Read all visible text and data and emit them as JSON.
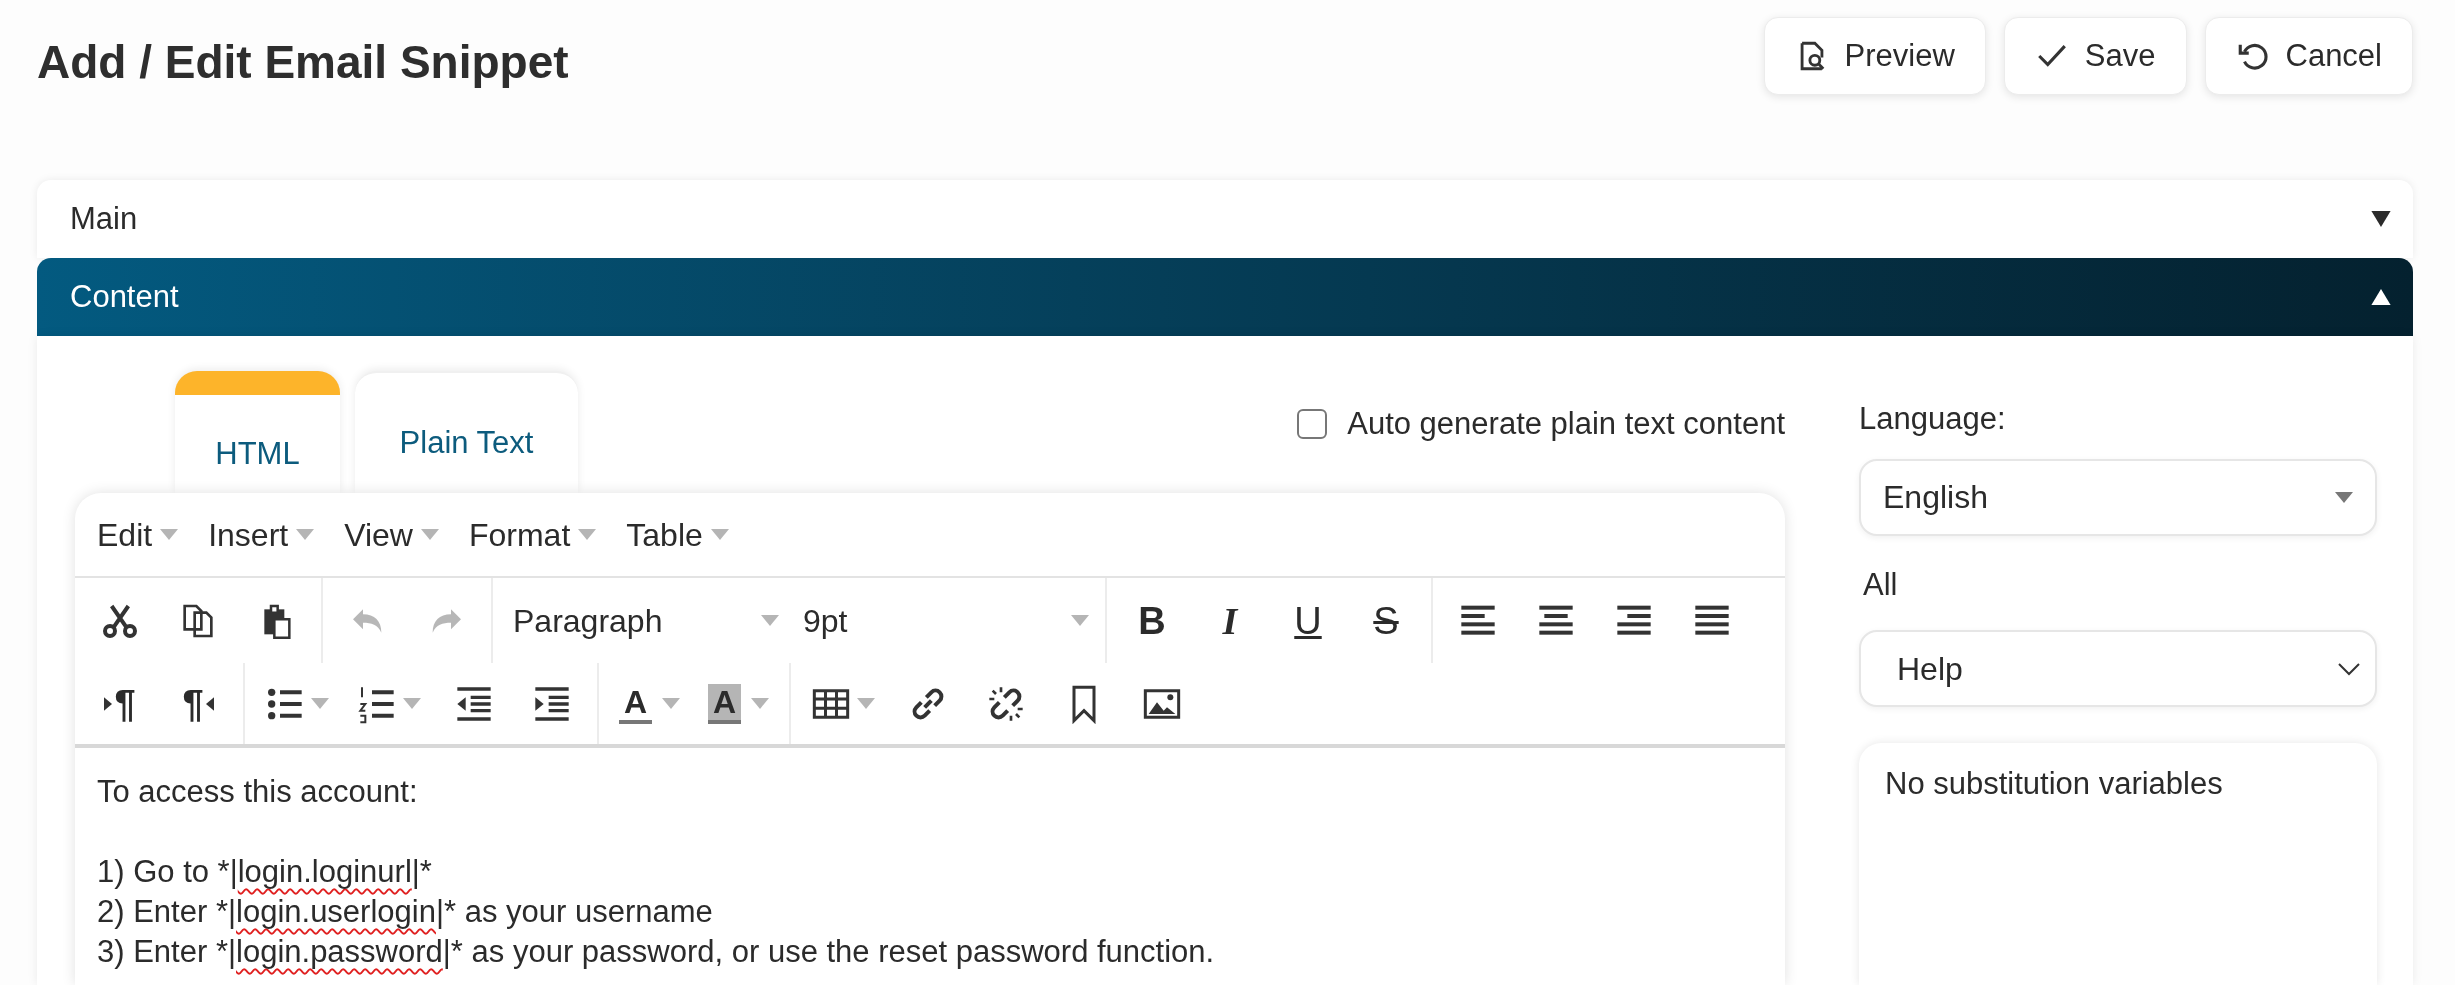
{
  "page_title": "Add / Edit Email Snippet",
  "actions": [
    {
      "label": "Preview",
      "kind": "preview"
    },
    {
      "label": "Save",
      "kind": "save"
    },
    {
      "label": "Cancel",
      "kind": "cancel"
    }
  ],
  "sections": [
    {
      "title": "Main",
      "expanded": false
    },
    {
      "title": "Content",
      "expanded": true
    }
  ],
  "tabs": [
    {
      "label": "HTML",
      "selected": true
    },
    {
      "label": "Plain Text",
      "selected": false
    }
  ],
  "auto_generate": {
    "label": "Auto generate plain text content",
    "checked": false
  },
  "editor": {
    "menus": [
      "Edit",
      "Insert",
      "View",
      "Format",
      "Table"
    ],
    "toolbar": {
      "undo_disabled": true,
      "redo_disabled": true,
      "block_format": "Paragraph",
      "font_size": "9pt",
      "bold": "B",
      "italic": "I",
      "underline": "U",
      "strikethrough": "S",
      "ltr": "¶",
      "rtl": "¶",
      "text_color": "A",
      "background_color": "A"
    },
    "paragraphs": [
      [
        [
          {
            "text": "To access this account:",
            "misspelled": false
          }
        ]
      ],
      [
        [
          {
            "text": "1) Go to *|",
            "misspelled": false
          },
          {
            "text": "login.loginurl",
            "misspelled": true
          },
          {
            "text": "|*",
            "misspelled": false
          }
        ],
        [
          {
            "text": "2) Enter *|",
            "misspelled": false
          },
          {
            "text": "login.userlogin",
            "misspelled": true
          },
          {
            "text": "|* as your username",
            "misspelled": false
          }
        ],
        [
          {
            "text": "3) Enter *|",
            "misspelled": false
          },
          {
            "text": "login.password",
            "misspelled": true
          },
          {
            "text": "|* as your password, or use the reset password function.",
            "misspelled": false
          }
        ]
      ]
    ]
  },
  "sidebar": {
    "language_label": "Language:",
    "language": "English",
    "filter_label": "All",
    "help_select": "Help",
    "variables_text": "No substitution variables"
  }
}
